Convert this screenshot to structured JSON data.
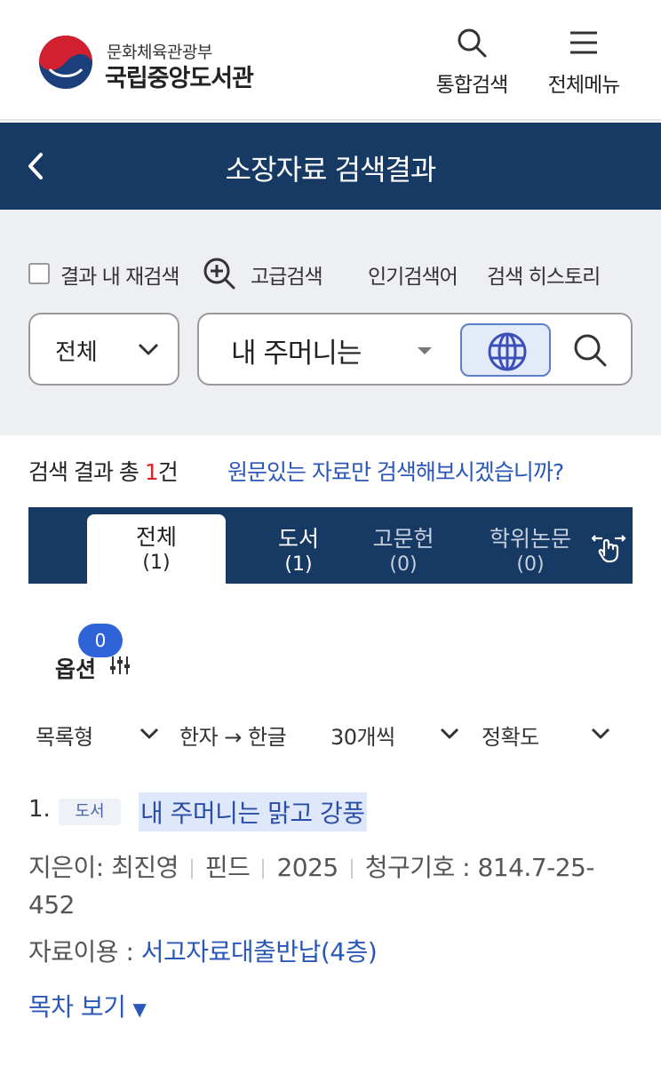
{
  "header": {
    "ministry": "문화체육관광부",
    "library_name": "국립중앙도서관",
    "search_label": "통합검색",
    "menu_label": "전체메뉴"
  },
  "titlebar": {
    "title": "소장자료 검색결과"
  },
  "search": {
    "refine_label": "결과 내 재검색",
    "advanced_label": "고급검색",
    "popular_label": "인기검색어",
    "history_label": "검색 히스토리",
    "scope_value": "전체",
    "query_value": "내 주머니는"
  },
  "results": {
    "prefix": "검색 결과 총 ",
    "count": "1",
    "suffix": "건",
    "origin_link": "원문있는 자료만 검색해보시겠습니까?"
  },
  "tabs": [
    {
      "label": "전체",
      "count": "(1)"
    },
    {
      "label": "도서",
      "count": "(1)"
    },
    {
      "label": "고문헌",
      "count": "(0)"
    },
    {
      "label": "학위논문",
      "count": "(0)"
    }
  ],
  "options": {
    "badge": "0",
    "label": "옵션",
    "view_mode": "목록형",
    "hanja": "한자 → 한글",
    "per_page": "30개씩",
    "sort": "정확도"
  },
  "item": {
    "number": "1.",
    "type": "도서",
    "title": "내 주머니는 맑고 강풍",
    "author": "지은이: 최진영",
    "publisher": "핀드",
    "year": "2025",
    "call_number": "청구기호 : 814.7-25-452",
    "use_label": "자료이용 : ",
    "use_location": "서고자료대출반납(4층)",
    "toc_label": "목차 보기"
  },
  "colors": {
    "navy": "#173a64",
    "link_blue": "#2b58b7",
    "count_red": "#d7262c",
    "badge_blue": "#2f63d8"
  }
}
